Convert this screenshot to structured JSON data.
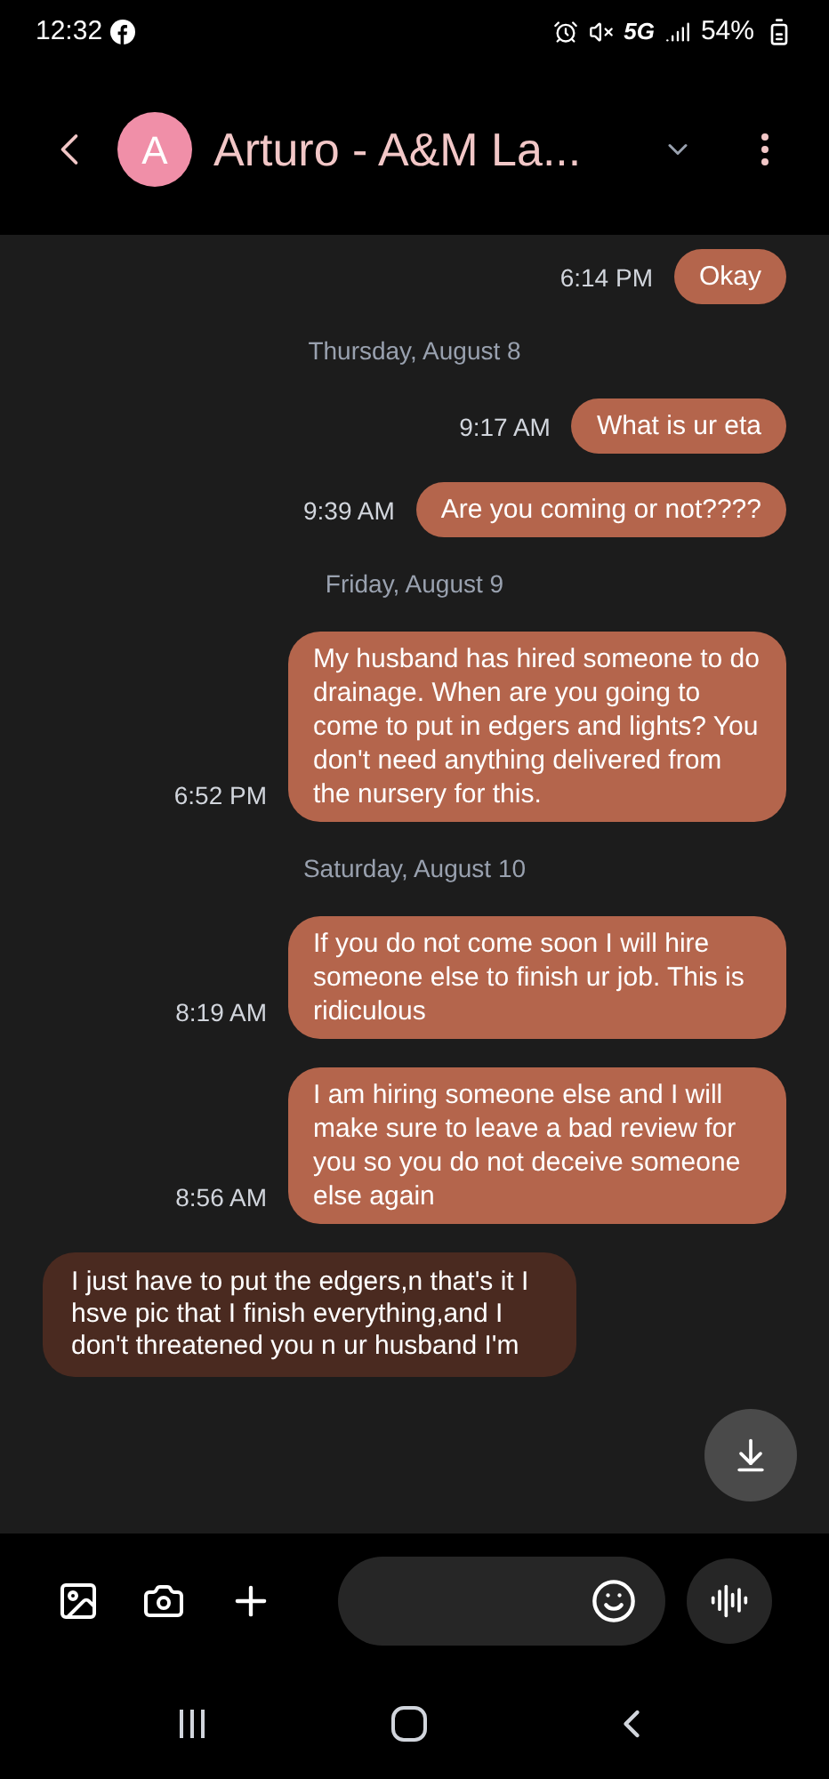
{
  "status_bar": {
    "time": "12:32",
    "network": "5G",
    "battery": "54%"
  },
  "header": {
    "avatar_letter": "A",
    "title": "Arturo - A&M La..."
  },
  "messages": [
    {
      "kind": "sent",
      "text": "Okay",
      "time": "6:14 PM"
    },
    {
      "kind": "date",
      "text": "Thursday, August 8"
    },
    {
      "kind": "sent",
      "text": "What is ur eta",
      "time": "9:17 AM"
    },
    {
      "kind": "sent",
      "text": "Are you coming or not????",
      "time": "9:39 AM"
    },
    {
      "kind": "date",
      "text": "Friday, August 9"
    },
    {
      "kind": "sent",
      "text": "My husband has hired someone to do drainage. When are you going to come to put in edgers and lights? You don't need anything delivered from the nursery for this.",
      "time": "6:52 PM"
    },
    {
      "kind": "date",
      "text": "Saturday, August 10"
    },
    {
      "kind": "sent",
      "text": "If you do not come soon I will hire someone else to finish ur job. This is ridiculous",
      "time": "8:19 AM"
    },
    {
      "kind": "sent",
      "text": "I am hiring someone else and I will make sure to leave a bad review for you so you do not deceive someone else again",
      "time": "8:56 AM"
    },
    {
      "kind": "received",
      "text": "I just have to put the edgers,n that's it I hsve pic that I finish everything,and I don't threatened you n ur husband I'm"
    }
  ]
}
